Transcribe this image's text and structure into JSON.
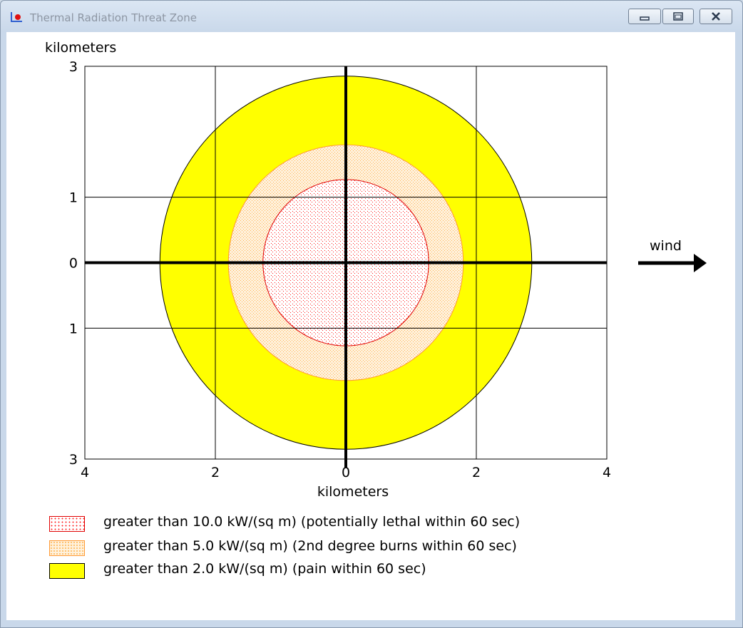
{
  "window": {
    "title": "Thermal Radiation Threat Zone",
    "buttons": {
      "minimize": "minimize",
      "maximize": "maximize",
      "close": "close"
    }
  },
  "chart_data": {
    "type": "threat-zone",
    "y_axis_label": "kilometers",
    "x_axis_label": "kilometers",
    "y_tick_labels": [
      "3",
      "1",
      "0",
      "1",
      "3"
    ],
    "x_tick_labels": [
      "4",
      "2",
      "0",
      "2",
      "4"
    ],
    "x_ticks_km": [
      -4,
      -2,
      0,
      2,
      4
    ],
    "y_ticks_km": [
      3,
      1,
      0,
      -1,
      -3
    ],
    "xlim": [
      -4,
      4
    ],
    "ylim": [
      -3,
      3
    ],
    "grid": true,
    "zones": [
      {
        "name": "greater than 2.0 kW/(sq m) (pain within 60 sec)",
        "radius_km": 2.85,
        "color": "#ffff00",
        "stroke": "#000000",
        "pattern": "solid"
      },
      {
        "name": "greater than 5.0 kW/(sq m) (2nd degree burns within 60 sec)",
        "radius_km": 1.8,
        "color": "#ffa500",
        "stroke": "#ff9933",
        "pattern": "dots"
      },
      {
        "name": "greater than 10.0 kW/(sq m) (potentially lethal within 60 sec)",
        "radius_km": 1.27,
        "color": "#ff0000",
        "stroke": "#e00000",
        "pattern": "dots"
      }
    ],
    "wind_label": "wind"
  },
  "legend": {
    "items": [
      {
        "label": "greater than 10.0 kW/(sq m) (potentially lethal within 60 sec)",
        "swatch": "lethal",
        "border": "#e00000"
      },
      {
        "label": "greater than 5.0 kW/(sq m) (2nd degree burns within 60 sec)",
        "swatch": "burns",
        "border": "#ff9933"
      },
      {
        "label": "greater than 2.0 kW/(sq m) (pain within 60 sec)",
        "swatch": "pain",
        "border": "#000000"
      }
    ]
  }
}
